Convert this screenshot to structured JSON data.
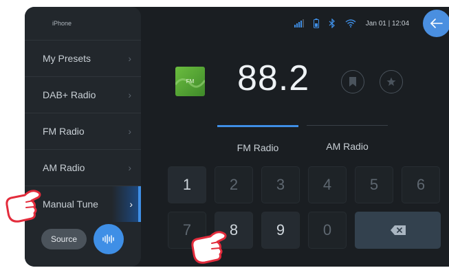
{
  "sidebar": {
    "device": "iPhone",
    "items": [
      {
        "label": "My Presets"
      },
      {
        "label": "DAB+ Radio"
      },
      {
        "label": "FM Radio"
      },
      {
        "label": "AM Radio"
      },
      {
        "label": "Manual Tune",
        "active": true
      }
    ],
    "source_label": "Source"
  },
  "status": {
    "datetime": "Jan 01 | 12:04"
  },
  "player": {
    "tile_label": "FM",
    "frequency": "88.2"
  },
  "tabs": {
    "fm": "FM Radio",
    "am": "AM Radio",
    "selected": "FM Radio"
  },
  "keypad": {
    "row1": [
      "1",
      "2",
      "3",
      "4",
      "5",
      "6"
    ],
    "row2": [
      "7",
      "8",
      "9",
      "0"
    ]
  },
  "colors": {
    "accent": "#3f8fe6",
    "fm_tile": "#5aa83a",
    "background": "#1a1e22"
  }
}
